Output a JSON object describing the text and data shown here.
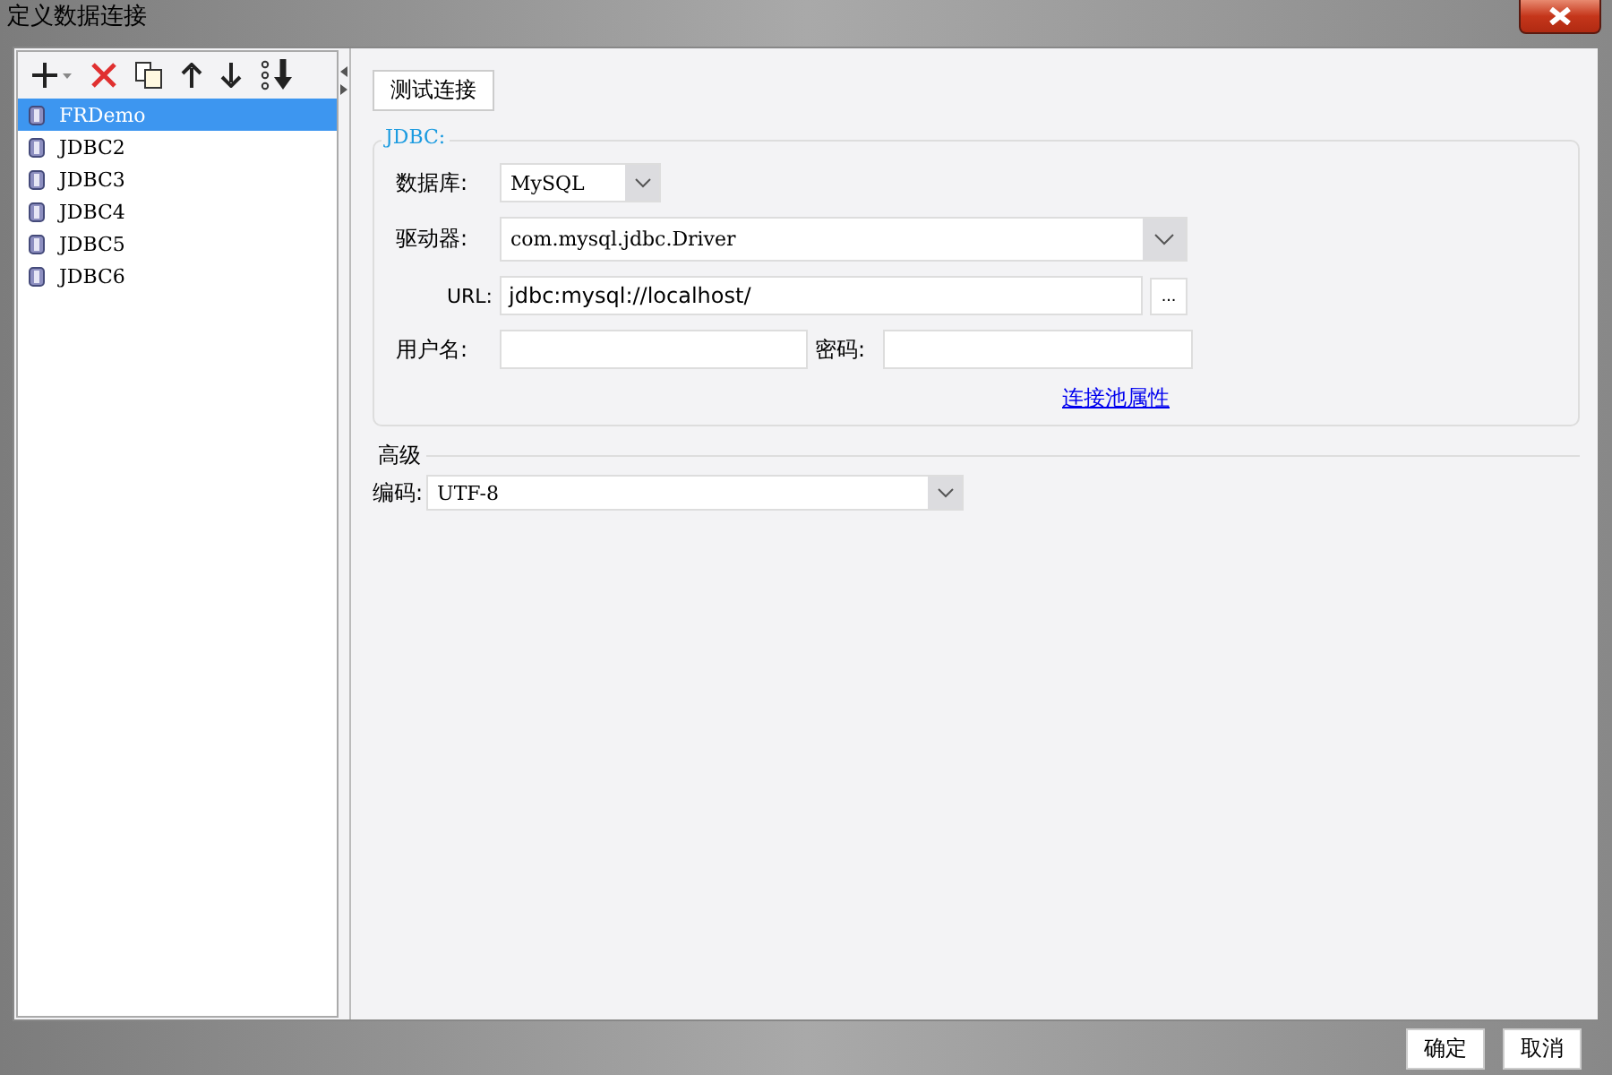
{
  "window": {
    "title": "定义数据连接"
  },
  "connections": [
    {
      "name": "FRDemo",
      "selected": true
    },
    {
      "name": "JDBC2",
      "selected": false
    },
    {
      "name": "JDBC3",
      "selected": false
    },
    {
      "name": "JDBC4",
      "selected": false
    },
    {
      "name": "JDBC5",
      "selected": false
    },
    {
      "name": "JDBC6",
      "selected": false
    }
  ],
  "test_button": "测试连接",
  "jdbc": {
    "legend": "JDBC:",
    "database_label": "数据库:",
    "database": "MySQL",
    "driver_label": "驱动器:",
    "driver": "com.mysql.jdbc.Driver",
    "url_label": "URL:",
    "url": "jdbc:mysql://localhost/",
    "browse_button": "...",
    "user_label": "用户名:",
    "password_label": "密码:",
    "pool_link": "连接池属性"
  },
  "advanced": {
    "legend": "高级",
    "encoding_label": "编码:",
    "encoding": "UTF-8"
  },
  "buttons": [
    "确定",
    "取消"
  ]
}
